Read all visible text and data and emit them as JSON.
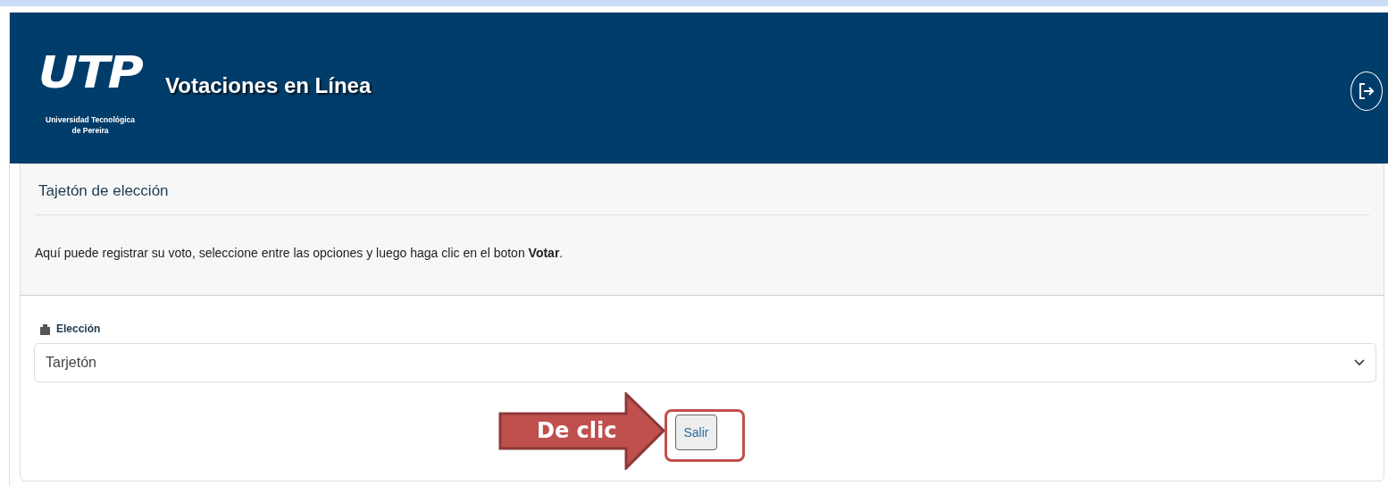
{
  "header": {
    "logo_text": "UTP",
    "university": "Universidad Tecnológica de Pereira",
    "title": "Votaciones en Línea"
  },
  "card": {
    "title": "Tajetón de elección",
    "instructions": "Aquí puede registrar su voto, seleccione entre las opciones y luego haga clic en el boton **Votar**.",
    "field": {
      "label": "Elección",
      "value": "Tarjetón"
    },
    "button": "Salir"
  },
  "annotation": {
    "label": "De clic"
  }
}
